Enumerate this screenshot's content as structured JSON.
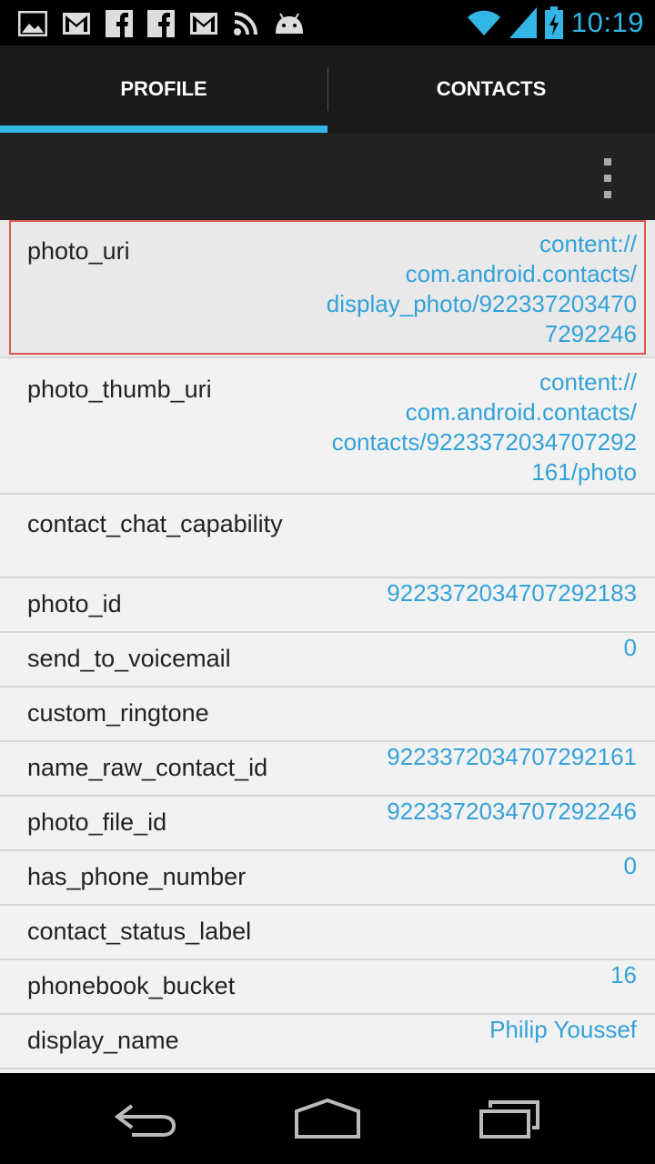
{
  "status_bar": {
    "time": "10:19",
    "left_icons": [
      "gallery-icon",
      "gmail-icon",
      "facebook-icon",
      "facebook-icon",
      "gmail-icon",
      "rss-icon",
      "android-icon"
    ],
    "right_icons": [
      "wifi-icon",
      "signal-icon",
      "battery-charging-icon"
    ]
  },
  "tabs": {
    "profile": "PROFILE",
    "contacts": "CONTACTS",
    "active": "PROFILE"
  },
  "colors": {
    "accent": "#33b5e5",
    "value_text": "#33a2d9",
    "selection_border": "#e0574f"
  },
  "rows": [
    {
      "key": "photo_uri",
      "value": "content://\ncom.android.contacts/\ndisplay_photo/922337203470\n7292246",
      "selected": true
    },
    {
      "key": "photo_thumb_uri",
      "value": "content://\ncom.android.contacts/\ncontacts/9223372034707292\n161/photo",
      "selected": false
    },
    {
      "key": "contact_chat_capability",
      "value": "",
      "selected": false
    },
    {
      "key": "photo_id",
      "value": "9223372034707292183",
      "selected": false
    },
    {
      "key": "send_to_voicemail",
      "value": "0",
      "selected": false
    },
    {
      "key": "custom_ringtone",
      "value": "",
      "selected": false
    },
    {
      "key": "name_raw_contact_id",
      "value": "9223372034707292161",
      "selected": false
    },
    {
      "key": "photo_file_id",
      "value": "9223372034707292246",
      "selected": false
    },
    {
      "key": "has_phone_number",
      "value": "0",
      "selected": false
    },
    {
      "key": "contact_status_label",
      "value": "",
      "selected": false
    },
    {
      "key": "phonebook_bucket",
      "value": "16",
      "selected": false
    },
    {
      "key": "display_name",
      "value": "Philip Youssef",
      "selected": false
    }
  ],
  "nav": [
    "back-icon",
    "home-icon",
    "recent-apps-icon"
  ]
}
